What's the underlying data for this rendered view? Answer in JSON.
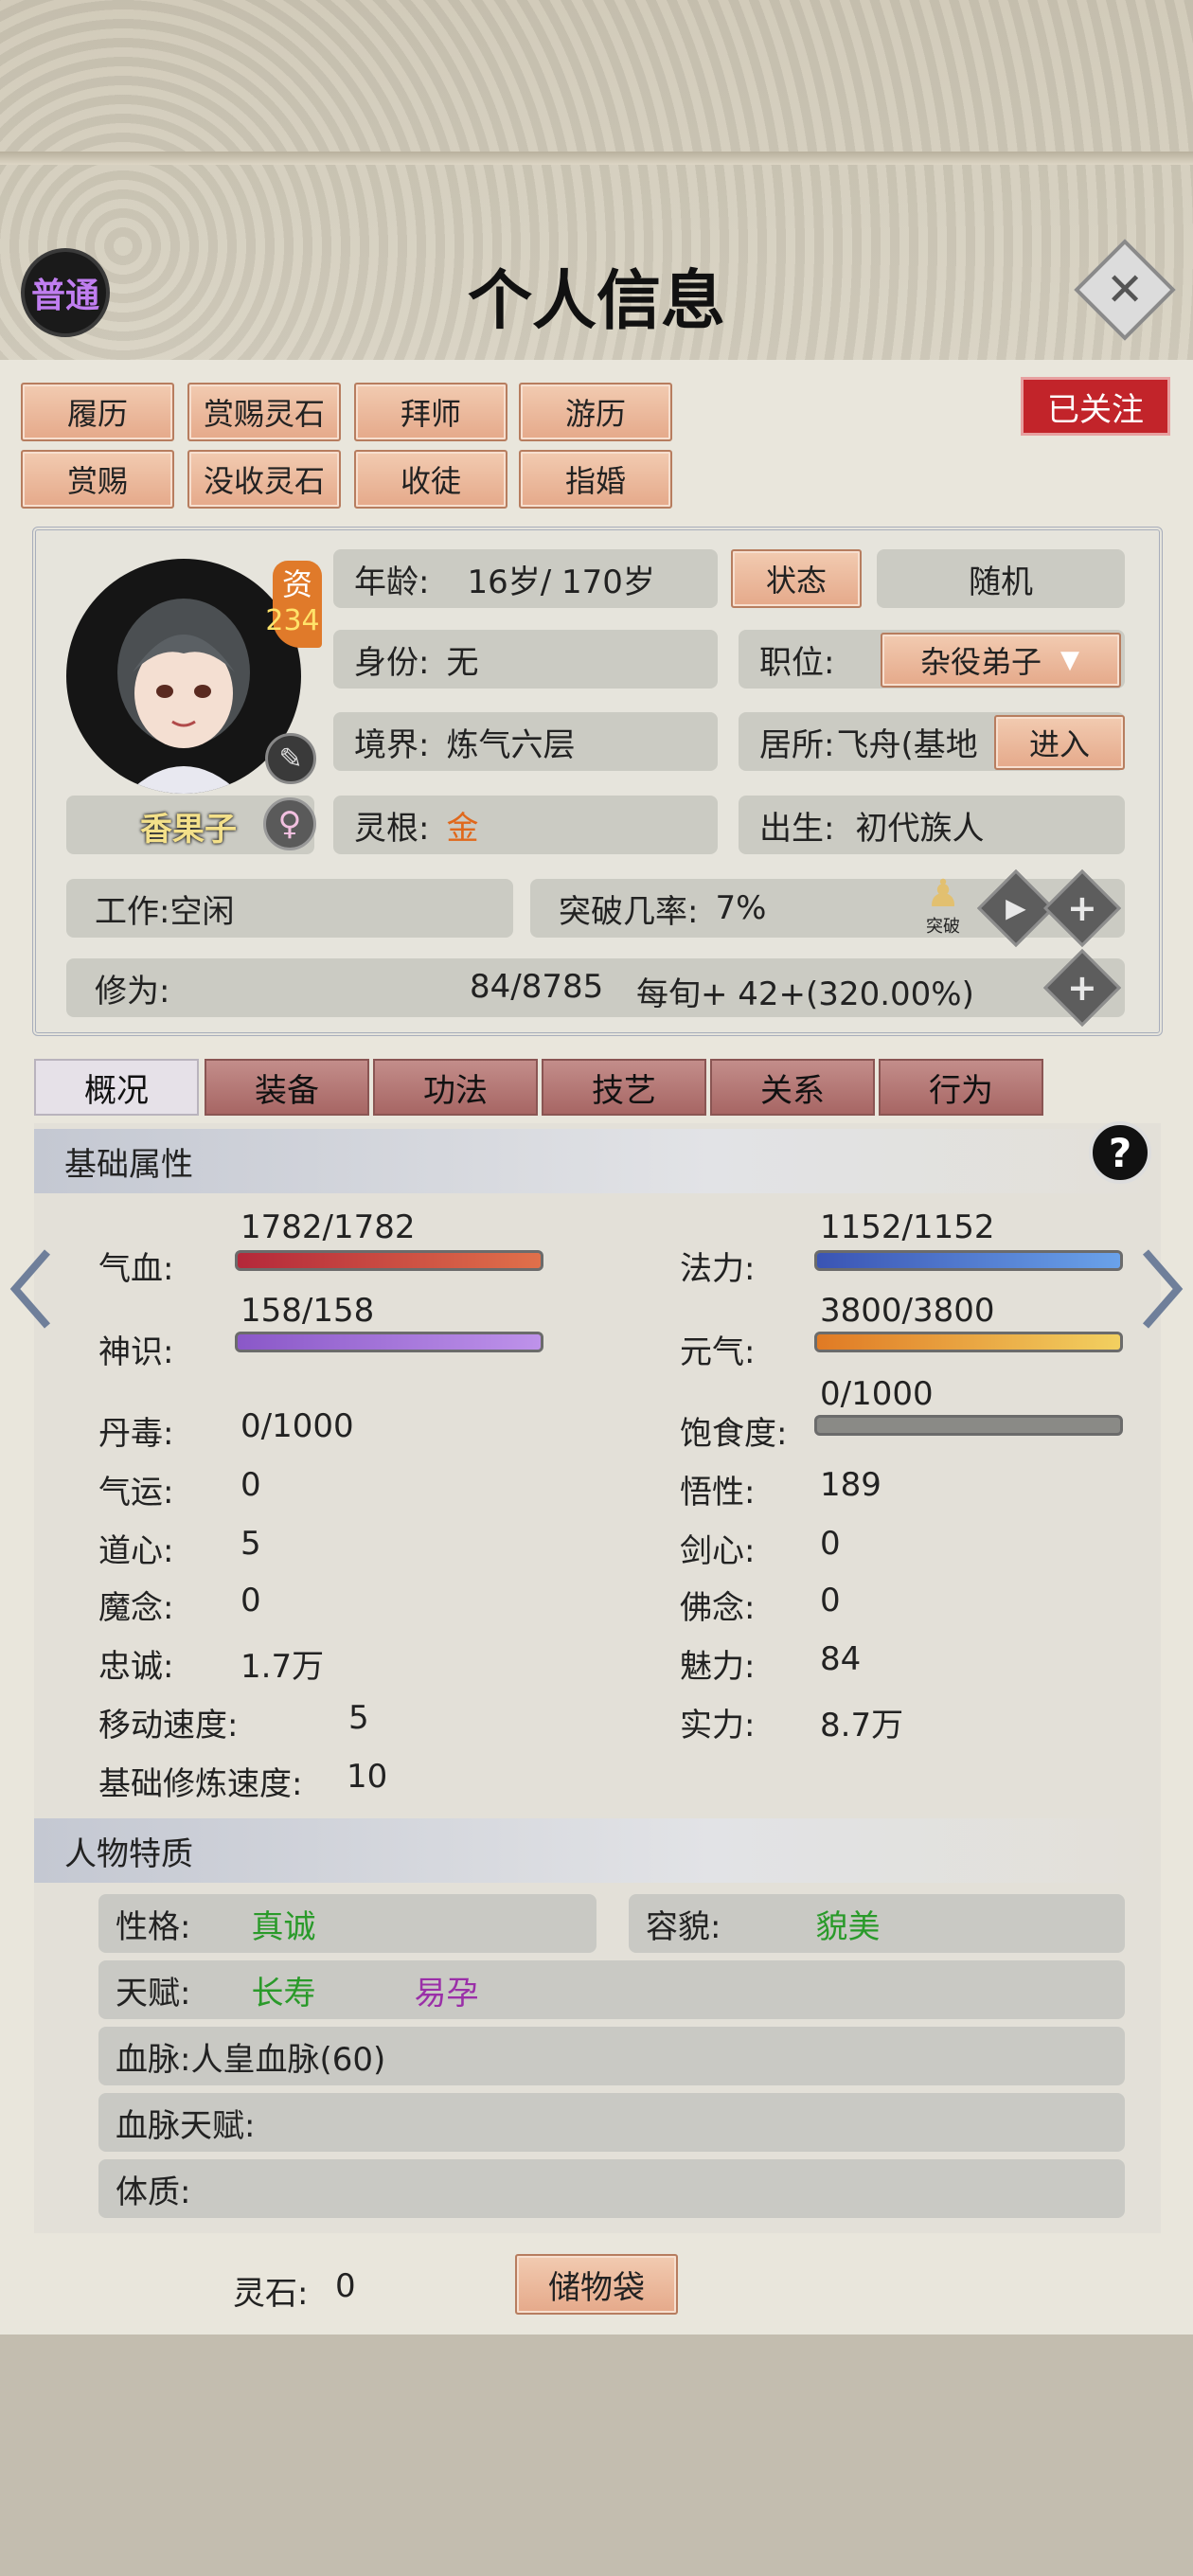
{
  "header": {
    "rank_badge": "普通",
    "title": "个人信息",
    "close_icon": "close-icon"
  },
  "actions": {
    "row1": [
      "履历",
      "赏赐灵石",
      "拜师",
      "游历"
    ],
    "row2": [
      "赏赐",
      "没收灵石",
      "收徒",
      "指婚"
    ],
    "follow": "已关注"
  },
  "character": {
    "name": "香果子",
    "aptitude_label": "资",
    "aptitude_value": "234",
    "age_label": "年龄:",
    "age_value": "16岁/ 170岁",
    "status_button": "状态",
    "random_button": "随机",
    "identity_label": "身份:",
    "identity_value": "无",
    "position_label": "职位:",
    "position_value": "杂役弟子",
    "realm_label": "境界:",
    "realm_value": "炼气六层",
    "residence_label": "居所:",
    "residence_value": "飞舟(基地",
    "enter_button": "进入",
    "root_label": "灵根:",
    "root_value": "金",
    "birth_label": "出生:",
    "birth_value": "初代族人",
    "work_label": "工作:",
    "work_value": "空闲",
    "breakthrough_label": "突破几率:",
    "breakthrough_value": "7%",
    "breakthrough_icon_text": "突破",
    "cultivation_label": "修为:",
    "cultivation_value": "84/8785",
    "cultivation_rate": "每旬+  42+(320.00%)"
  },
  "tabs": [
    "概况",
    "装备",
    "功法",
    "技艺",
    "关系",
    "行为"
  ],
  "basic": {
    "title": "基础属性",
    "hp_label": "气血:",
    "hp_value": "1782/1782",
    "hp_fill": 1.0,
    "mana_label": "法力:",
    "mana_value": "1152/1152",
    "mana_fill": 1.0,
    "sense_label": "神识:",
    "sense_value": "158/158",
    "sense_fill": 1.0,
    "vital_label": "元气:",
    "vital_value": "3800/3800",
    "vital_fill": 1.0,
    "poison_label": "丹毒:",
    "poison_value": "0/1000",
    "satiety_label": "饱食度:",
    "satiety_value": "0/1000",
    "satiety_fill": 0.0,
    "luck_label": "气运:",
    "luck_value": "0",
    "insight_label": "悟性:",
    "insight_value": "189",
    "dao_label": "道心:",
    "dao_value": "5",
    "sword_label": "剑心:",
    "sword_value": "0",
    "demon_label": "魔念:",
    "demon_value": "0",
    "buddha_label": "佛念:",
    "buddha_value": "0",
    "loyal_label": "忠诚:",
    "loyal_value": "1.7万",
    "charm_label": "魅力:",
    "charm_value": "84",
    "speed_label": "移动速度:",
    "speed_value": "5",
    "power_label": "实力:",
    "power_value": "8.7万",
    "train_label": "基础修炼速度:",
    "train_value": "10"
  },
  "traits": {
    "title": "人物特质",
    "personality_label": "性格:",
    "personality_value": "真诚",
    "looks_label": "容貌:",
    "looks_value": "貌美",
    "talent_label": "天赋:",
    "talent_1": "长寿",
    "talent_2": "易孕",
    "bloodline_label": "血脉:",
    "bloodline_value": "人皇血脉(60)",
    "blood_talent_label": "血脉天赋:",
    "physique_label": "体质:"
  },
  "footer": {
    "stones_label": "灵石:",
    "stones_value": "0",
    "bag_button": "储物袋"
  },
  "colors": {
    "hp": "#c0303a",
    "mana": "#3f66c8",
    "sense": "#9a6ad6",
    "vital": "#e08a2a",
    "follow": "#c2242a",
    "root_gold": "#e0681c",
    "trait_green": "#2a9a2a",
    "trait_purple": "#9a2fa8"
  }
}
